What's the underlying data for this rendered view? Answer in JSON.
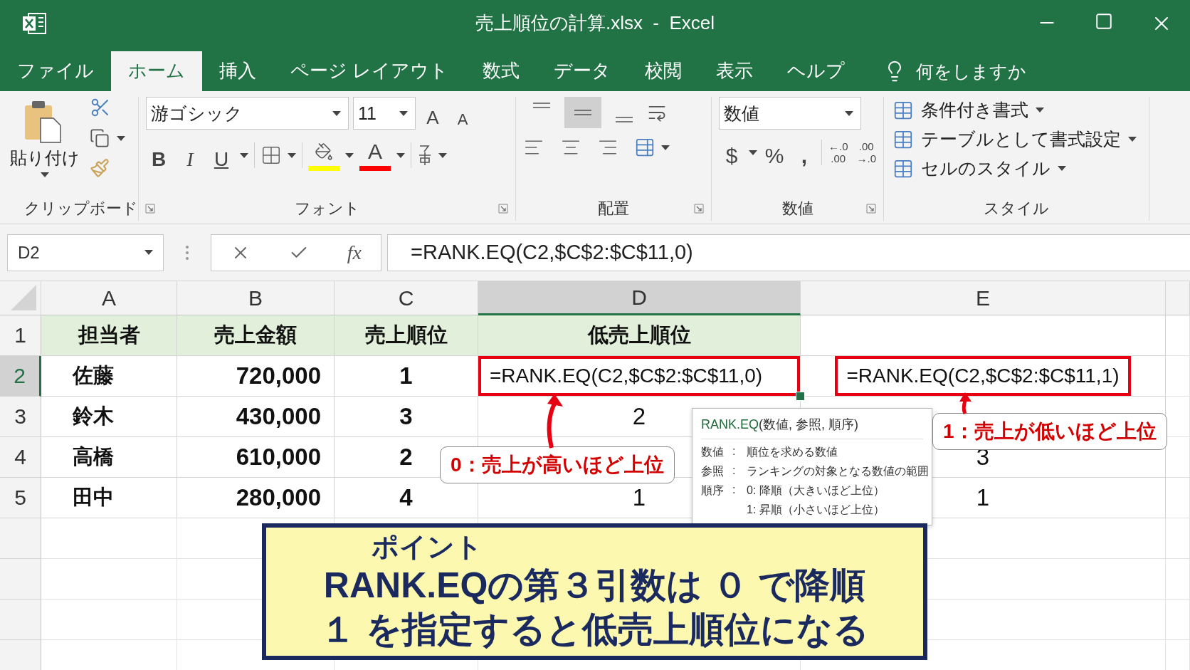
{
  "window": {
    "title": "売上順位の計算.xlsx  -  Excel"
  },
  "tabs": [
    {
      "label": "ファイル",
      "selected": false
    },
    {
      "label": "ホーム",
      "selected": true
    },
    {
      "label": "挿入",
      "selected": false
    },
    {
      "label": "ページ レイアウト",
      "selected": false
    },
    {
      "label": "数式",
      "selected": false
    },
    {
      "label": "データ",
      "selected": false
    },
    {
      "label": "校閲",
      "selected": false
    },
    {
      "label": "表示",
      "selected": false
    },
    {
      "label": "ヘルプ",
      "selected": false
    }
  ],
  "tell_me": {
    "placeholder": "何をしますか"
  },
  "ribbon": {
    "clipboard": {
      "paste_label": "貼り付け",
      "label": "クリップボード"
    },
    "font": {
      "font_name": "游ゴシック",
      "font_size": "11",
      "grow": "A",
      "shrink": "A",
      "bold": "B",
      "italic": "I",
      "underline": "U",
      "font_color": "A",
      "label": "フォント"
    },
    "alignment": {
      "vertical": [
        {
          "selected": false
        },
        {
          "selected": true
        },
        {
          "selected": false
        }
      ],
      "label": "配置"
    },
    "number": {
      "format": "数値",
      "currency": "$",
      "percent": "%",
      "comma": ",",
      "decimals": [
        {
          "top": "←.0",
          "bottom": ".00"
        },
        {
          "top": ".00",
          "bottom": "→.0"
        }
      ],
      "label": "数値"
    },
    "styles": {
      "items": [
        "条件付き書式",
        "テーブルとして書式設定",
        "セルのスタイル"
      ],
      "label": "スタイル"
    }
  },
  "formula_bar": {
    "name_box": "D2",
    "fx": "fx",
    "formula": "=RANK.EQ(C2,$C$2:$C$11,0)"
  },
  "sheet": {
    "columns": [
      {
        "label": "A",
        "selected": false
      },
      {
        "label": "B",
        "selected": false
      },
      {
        "label": "C",
        "selected": false
      },
      {
        "label": "D",
        "selected": true
      },
      {
        "label": "E",
        "selected": false
      }
    ],
    "rows": [
      {
        "number": "1",
        "selected": false,
        "cells": [
          {
            "kind": "header",
            "text": "担当者"
          },
          {
            "kind": "header",
            "text": "売上金額"
          },
          {
            "kind": "header",
            "text": "売上順位"
          },
          {
            "kind": "header",
            "text": "低売上順位"
          },
          {
            "kind": "empty"
          }
        ]
      },
      {
        "number": "2",
        "selected": true,
        "cells": [
          {
            "kind": "name",
            "text": "佐藤"
          },
          {
            "kind": "number",
            "text": "720,000"
          },
          {
            "kind": "rank",
            "text": "1"
          },
          {
            "kind": "formula",
            "text": "=RANK.EQ(C2,$C$2:$C$11,0)"
          },
          {
            "kind": "formula",
            "text": "=RANK.EQ(C2,$C$2:$C$11,1)"
          }
        ]
      },
      {
        "number": "3",
        "selected": false,
        "cells": [
          {
            "kind": "name",
            "text": "鈴木"
          },
          {
            "kind": "number",
            "text": "430,000"
          },
          {
            "kind": "rank",
            "text": "3"
          },
          {
            "kind": "plain",
            "text": "2"
          },
          {
            "kind": "empty"
          }
        ]
      },
      {
        "number": "4",
        "selected": false,
        "cells": [
          {
            "kind": "name",
            "text": "高橋"
          },
          {
            "kind": "number",
            "text": "610,000"
          },
          {
            "kind": "rank",
            "text": "2"
          },
          {
            "kind": "empty"
          },
          {
            "kind": "plain",
            "text": "3"
          }
        ]
      },
      {
        "number": "5",
        "selected": false,
        "cells": [
          {
            "kind": "name",
            "text": "田中"
          },
          {
            "kind": "number",
            "text": "280,000"
          },
          {
            "kind": "rank",
            "text": "4"
          },
          {
            "kind": "plain",
            "text": "1"
          },
          {
            "kind": "plain",
            "text": "1"
          }
        ]
      }
    ]
  },
  "callouts": [
    {
      "text": "0：売上が高いほど上位"
    },
    {
      "text": "1：売上が低いほど上位"
    }
  ],
  "tooltip": {
    "function": "RANK.EQ",
    "signature": "(数値, 参照, 順序)",
    "rows": [
      {
        "term": "数値",
        "separator": ":",
        "description": "順位を求める数値"
      },
      {
        "term": "参照",
        "separator": ":",
        "description": "ランキングの対象となる数値の範囲"
      },
      {
        "term": "順序",
        "separator": ":",
        "description": "0: 降順（大きいほど上位）"
      },
      {
        "description": "1: 昇順（小さいほど上位）"
      }
    ]
  },
  "point": {
    "heading": "ポイント",
    "lines": [
      "RANK.EQの第３引数は ０ で降順",
      "１ を指定すると低売上順位になる"
    ]
  }
}
